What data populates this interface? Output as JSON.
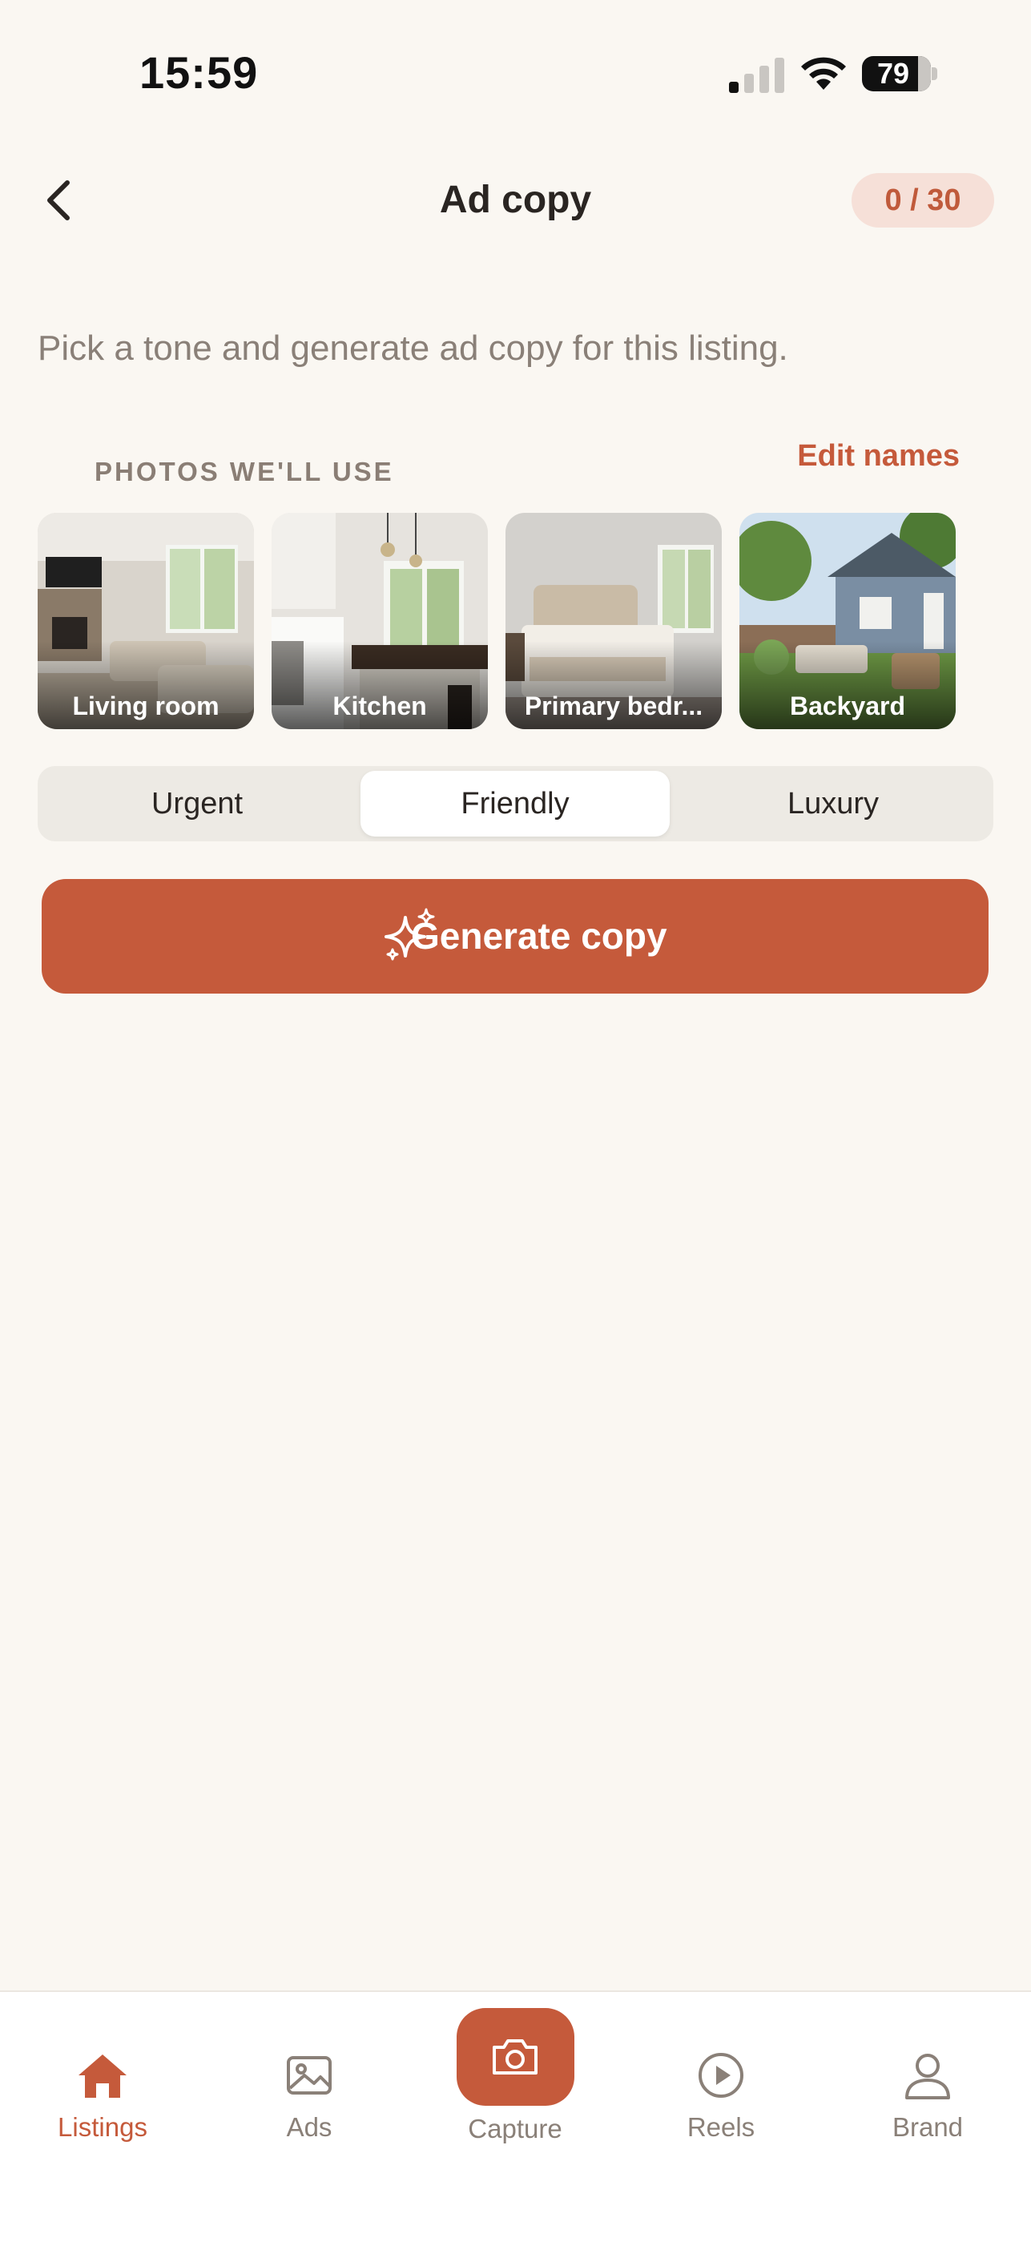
{
  "status_bar": {
    "time": "15:59",
    "battery": "79"
  },
  "header": {
    "title": "Ad copy",
    "counter": "0 / 30"
  },
  "subtitle": "Pick a tone and generate ad copy for this listing.",
  "photos_section": {
    "label": "PHOTOS WE'LL USE",
    "edit_label": "Edit names",
    "photos": [
      {
        "caption": "Living room"
      },
      {
        "caption": "Kitchen"
      },
      {
        "caption": "Primary bedr..."
      },
      {
        "caption": "Backyard"
      }
    ]
  },
  "tones": {
    "options": [
      "Urgent",
      "Friendly",
      "Luxury"
    ],
    "selected": "Friendly"
  },
  "generate_button": {
    "label": "Generate copy",
    "icon": "sparkles-icon"
  },
  "tab_bar": {
    "items": [
      {
        "label": "Listings",
        "icon": "home-icon",
        "active": true
      },
      {
        "label": "Ads",
        "icon": "image-icon",
        "active": false
      },
      {
        "label": "Capture",
        "icon": "camera-icon",
        "active": false
      },
      {
        "label": "Reels",
        "icon": "play-circle-icon",
        "active": false
      },
      {
        "label": "Brand",
        "icon": "person-icon",
        "active": false
      }
    ]
  },
  "colors": {
    "accent": "#C55A3B",
    "background": "#FAF7F2",
    "counter_bg": "#F6E0D8"
  }
}
